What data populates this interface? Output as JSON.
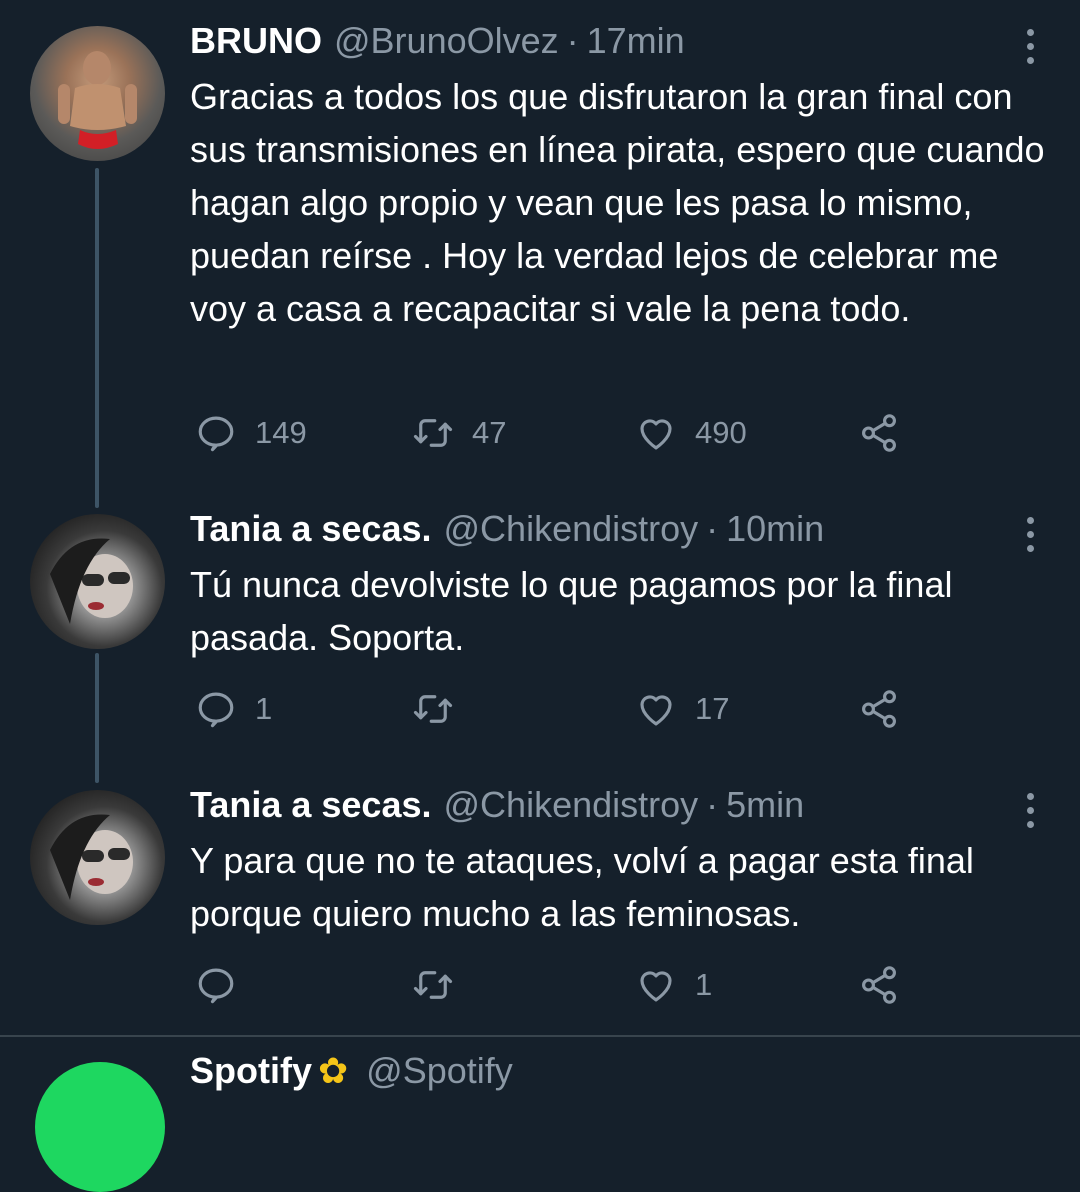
{
  "tweets": [
    {
      "name": "BRUNO",
      "handle": "@BrunoOlvez",
      "separator": "·",
      "time": "17min",
      "text": "Gracias a todos los que disfrutaron la gran final con sus transmisiones en línea pirata, espero que cuando hagan algo propio y vean que les pasa lo mismo, puedan reírse . Hoy la verdad lejos de celebrar me voy a casa a recapacitar si vale la pena todo.",
      "replies": "149",
      "retweets": "47",
      "likes": "490"
    },
    {
      "name": "Tania a secas.",
      "handle": "@Chikendistroy",
      "separator": "·",
      "time": "10min",
      "text": "Tú nunca devolviste lo que pagamos por la final pasada. Soporta.",
      "replies": "1",
      "retweets": "",
      "likes": "17"
    },
    {
      "name": "Tania a secas.",
      "handle": "@Chikendistroy",
      "separator": "·",
      "time": "5min",
      "text": "Y para que no te ataques, volví a pagar esta final porque quiero mucho a las feminosas.",
      "replies": "",
      "retweets": "",
      "likes": "1"
    }
  ],
  "next_tweet": {
    "name": "Spotify",
    "handle": "@Spotify"
  },
  "icons": {
    "reply": "reply-icon",
    "retweet": "retweet-icon",
    "like": "heart-icon",
    "share": "share-icon",
    "more": "more-vertical-icon",
    "verified": "verified-badge-icon"
  },
  "colors": {
    "background": "#15202b",
    "text": "#ffffff",
    "secondary": "#8b98a5",
    "thread_line": "#3d5466",
    "spotify_green": "#1ed760"
  }
}
